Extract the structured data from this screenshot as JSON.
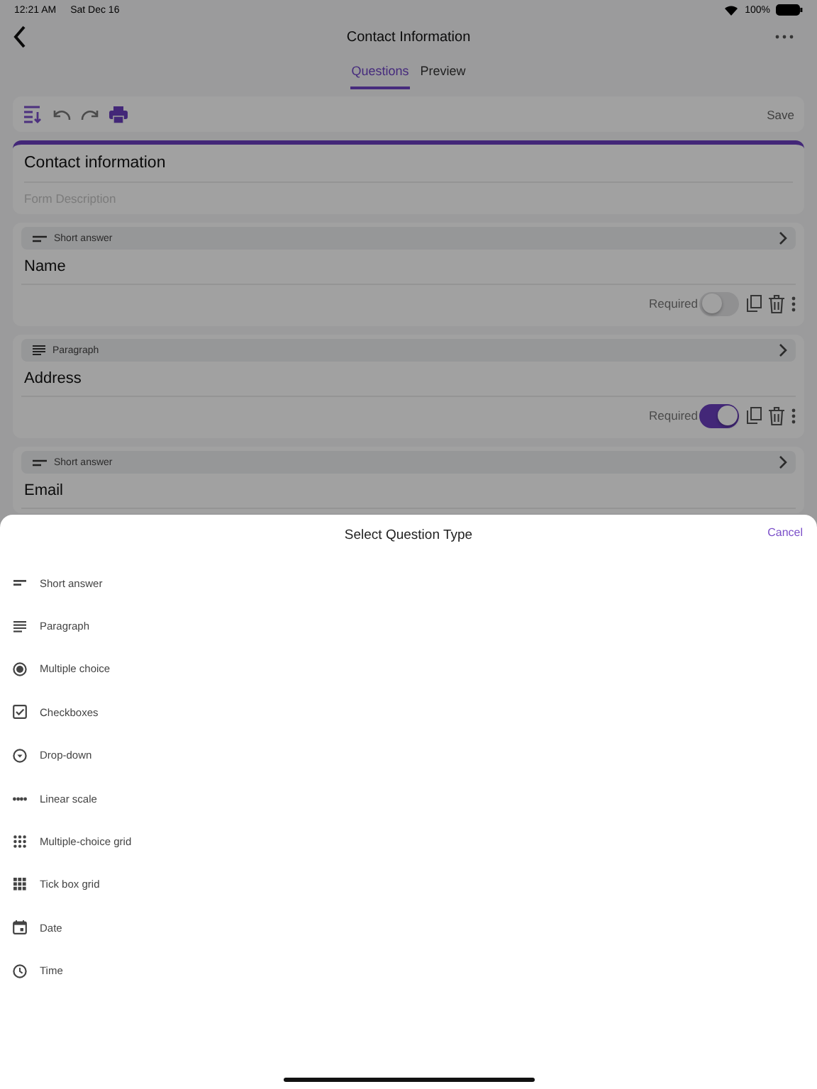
{
  "status_bar": {
    "time": "12:21 AM",
    "date": "Sat Dec 16",
    "battery": "100%"
  },
  "nav": {
    "title": "Contact Information"
  },
  "tabs": [
    {
      "label": "Questions",
      "selected": true
    },
    {
      "label": "Preview",
      "selected": false
    }
  ],
  "toolbar": {
    "save": "Save"
  },
  "form": {
    "title": "Contact information",
    "description_placeholder": "Form Description"
  },
  "questions": [
    {
      "type": "Short answer",
      "kind": "short",
      "title": "Name",
      "required_label": "Required",
      "required": false
    },
    {
      "type": "Paragraph",
      "kind": "paragraph",
      "title": "Address",
      "required_label": "Required",
      "required": true
    },
    {
      "type": "Short answer",
      "kind": "short",
      "title": "Email"
    }
  ],
  "sheet": {
    "title": "Select Question Type",
    "cancel": "Cancel",
    "options": [
      {
        "label": "Short answer",
        "kind": "short"
      },
      {
        "label": "Paragraph",
        "kind": "paragraph"
      },
      {
        "label": "Multiple choice",
        "kind": "radio"
      },
      {
        "label": "Checkboxes",
        "kind": "checkbox"
      },
      {
        "label": "Drop-down",
        "kind": "dropdown"
      },
      {
        "label": "Linear scale",
        "kind": "scale"
      },
      {
        "label": "Multiple-choice grid",
        "kind": "grid"
      },
      {
        "label": "Tick box grid",
        "kind": "tickgrid"
      },
      {
        "label": "Date",
        "kind": "date"
      },
      {
        "label": "Time",
        "kind": "time"
      }
    ]
  }
}
